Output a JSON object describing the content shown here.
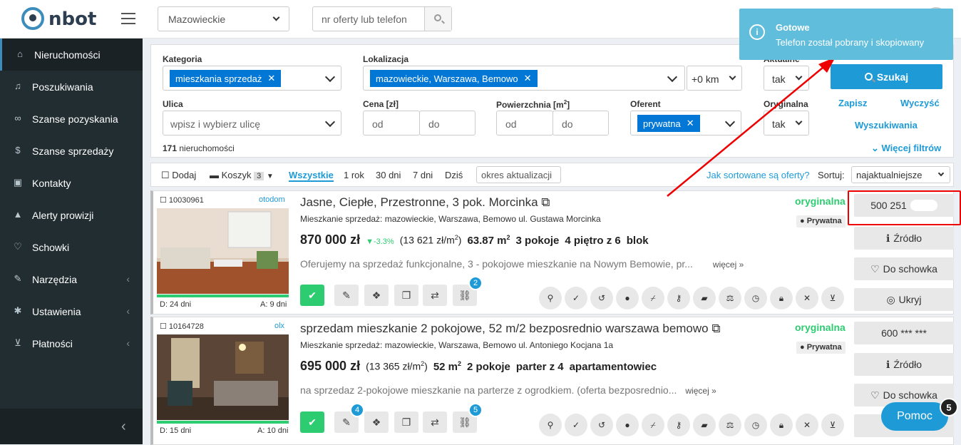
{
  "brand": {
    "name": "nbot"
  },
  "header": {
    "region": "Mazowieckie",
    "search_placeholder": "nr oferty lub telefon"
  },
  "sidebar": {
    "items": [
      {
        "label": "Nieruchomości",
        "icon": "home-icon"
      },
      {
        "label": "Poszukiwania",
        "icon": "bell-icon"
      },
      {
        "label": "Szanse pozyskania",
        "icon": "handshake-icon"
      },
      {
        "label": "Szanse sprzedaży",
        "icon": "dollar-icon"
      },
      {
        "label": "Kontakty",
        "icon": "contact-icon"
      },
      {
        "label": "Alerty prowizji",
        "icon": "warning-icon"
      },
      {
        "label": "Schowki",
        "icon": "heart-icon"
      },
      {
        "label": "Narzędzia",
        "icon": "wrench-icon"
      },
      {
        "label": "Ustawienia",
        "icon": "gear-icon"
      },
      {
        "label": "Płatności",
        "icon": "cart-icon"
      }
    ]
  },
  "filters": {
    "kategoria_label": "Kategoria",
    "kategoria_value": "mieszkania sprzedaż",
    "lokalizacja_label": "Lokalizacja",
    "lokalizacja_value": "mazowieckie, Warszawa, Bemowo",
    "radius": "+0 km",
    "aktualna_label": "Aktualne",
    "aktualna_value": "tak",
    "search_button": "Szukaj",
    "ulica_label": "Ulica",
    "ulica_placeholder": "wpisz i wybierz ulicę",
    "cena_label": "Cena [zł]",
    "od": "od",
    "do": "do",
    "pow_label": "Powierzchnia [m",
    "pow_sup": "2",
    "pow_close": "]",
    "oferent_label": "Oferent",
    "oferent_value": "prywatna",
    "oryginalna_label": "Oryginalna",
    "oryginalna_value": "tak",
    "zapisz": "Zapisz",
    "wyczysc": "Wyczyść",
    "wyszukiwania": "Wyszukiwania",
    "count": "171",
    "count_suffix": " nieruchomości",
    "more_filters": "Więcej filtrów"
  },
  "toolbar": {
    "dodaj": "Dodaj",
    "koszyk": "Koszyk",
    "koszyk_count": "3",
    "periods": [
      "Wszystkie",
      "1 rok",
      "30 dni",
      "7 dni",
      "Dziś"
    ],
    "okres": "okres aktualizacji",
    "sort_help": "Jak sortowane są oferty?",
    "sort_label": "Sortuj:",
    "sort_value": "najaktualniejsze"
  },
  "listings": [
    {
      "id": "10030961",
      "source": "otodom",
      "title": "Jasne, Ciepłe, Przestronne, 3 pok. Morcinka",
      "address": "Mieszkanie sprzedaż: mazowieckie, Warszawa, Bemowo ul. Gustawa Morcinka",
      "price": "870 000 zł",
      "change": "-3.3%",
      "ppm": "(13 621 zł/m",
      "ppm_sup": "2",
      "ppm_close": ")",
      "area": "63.87 m",
      "area_sup": "2",
      "rooms": "3 pokoje",
      "floor": "4 piętro z 6",
      "type": "blok",
      "desc": "Oferujemy na sprzedaż funkcjonalne, 3 - pokojowe mieszkanie na Nowym Bemowie, pr...",
      "more": "więcej »",
      "orig": "oryginalna",
      "owner": "Prywatna",
      "d": "D: 24 dni",
      "a": "A: 9 dni",
      "phone": "500 251",
      "badge_link": "2"
    },
    {
      "id": "10164728",
      "source": "olx",
      "title": "sprzedam mieszkanie 2 pokojowe, 52 m/2 bezposrednio warszawa bemowo",
      "address": "Mieszkanie sprzedaż: mazowieckie, Warszawa, Bemowo ul. Antoniego Kocjana 1a",
      "price": "695 000 zł",
      "ppm": "(13 365 zł/m",
      "ppm_sup": "2",
      "ppm_close": ")",
      "area": "52 m",
      "area_sup": "2",
      "rooms": "2 pokoje",
      "floor": "parter z 4",
      "type": "apartamentowiec",
      "desc": "na sprzedaz 2-pokojowe mieszkanie na parterze z ogrodkiem. (oferta bezposrednio...",
      "more": "więcej »",
      "orig": "oryginalna",
      "owner": "Prywatna",
      "d": "D: 15 dni",
      "a": "A: 10 dni",
      "phone": "600 *** ***",
      "badge_edit": "4",
      "badge_link": "5"
    }
  ],
  "side_actions": {
    "zrodlo": "Źródło",
    "schowek": "Do schowka",
    "ukryj": "Ukryj"
  },
  "toast": {
    "title": "Gotowe",
    "message": "Telefon został pobrany i skopiowany"
  },
  "help": {
    "label": "Pomoc",
    "count": "5"
  },
  "colors": {
    "accent": "#1e9bd7",
    "sidebar": "#222d32",
    "green": "#2ecc71",
    "toast": "#60bddb",
    "annotation": "#e00000"
  }
}
